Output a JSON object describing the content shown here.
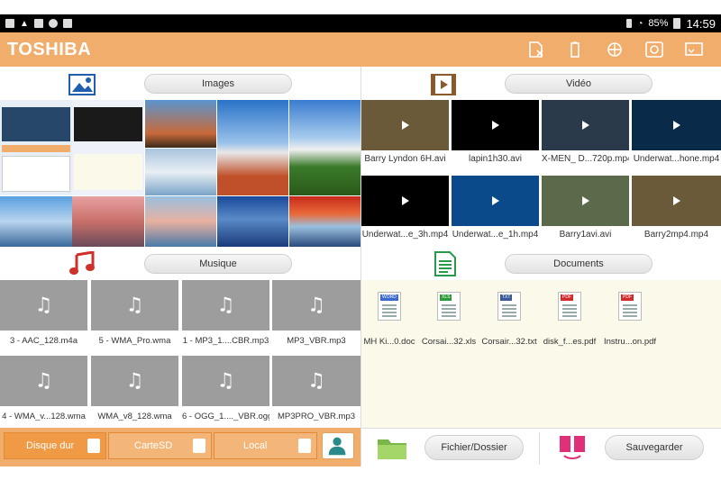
{
  "status": {
    "battery": "85%",
    "time": "14:59"
  },
  "app": {
    "logo": "TOSHIBA"
  },
  "images": {
    "label": "Images"
  },
  "video": {
    "label": "Vidéo",
    "items": [
      {
        "name": "Barry Lyndon 6H.avi",
        "color": "#6a5a3a"
      },
      {
        "name": "lapin1h30.avi",
        "color": "#000000"
      },
      {
        "name": "X-MEN_ D...720p.mp4",
        "color": "#2a3a4a"
      },
      {
        "name": "Underwat...hone.mp4",
        "color": "#0a2a4a"
      },
      {
        "name": "Underwat...e_3h.mp4",
        "color": "#000000"
      },
      {
        "name": "Underwat...e_1h.mp4",
        "color": "#0a4a8a"
      },
      {
        "name": "Barry1avi.avi",
        "color": "#5a6a4a"
      },
      {
        "name": "Barry2mp4.mp4",
        "color": "#6a5a3a"
      }
    ]
  },
  "music": {
    "label": "Musique",
    "items": [
      {
        "name": "3 - AAC_128.m4a"
      },
      {
        "name": "5 - WMA_Pro.wma"
      },
      {
        "name": "1 - MP3_1....CBR.mp3"
      },
      {
        "name": "MP3_VBR.mp3"
      },
      {
        "name": "4 - WMA_v...128.wma"
      },
      {
        "name": "WMA_v8_128.wma"
      },
      {
        "name": "6 - OGG_1...._VBR.ogg"
      },
      {
        "name": "MP3PRO_VBR.mp3"
      }
    ]
  },
  "documents": {
    "label": "Documents",
    "items": [
      {
        "name": "MH Ki...0.doc",
        "tag": "WORD",
        "color": "#3a6ad0"
      },
      {
        "name": "Corsai...32.xls",
        "tag": "XLS",
        "color": "#2a9a3a"
      },
      {
        "name": "Corsair...32.txt",
        "tag": "TXT",
        "color": "#3a5a9a"
      },
      {
        "name": "disk_f...es.pdf",
        "tag": "PDF",
        "color": "#d02a2a"
      },
      {
        "name": "Instru...on.pdf",
        "tag": "PDF",
        "color": "#d02a2a"
      }
    ]
  },
  "bottom": {
    "tabs": [
      {
        "label": "Disque dur"
      },
      {
        "label": "CarteSD"
      },
      {
        "label": "Local"
      }
    ],
    "fichier": "Fichier/Dossier",
    "sauvegarder": "Sauvegarder"
  }
}
